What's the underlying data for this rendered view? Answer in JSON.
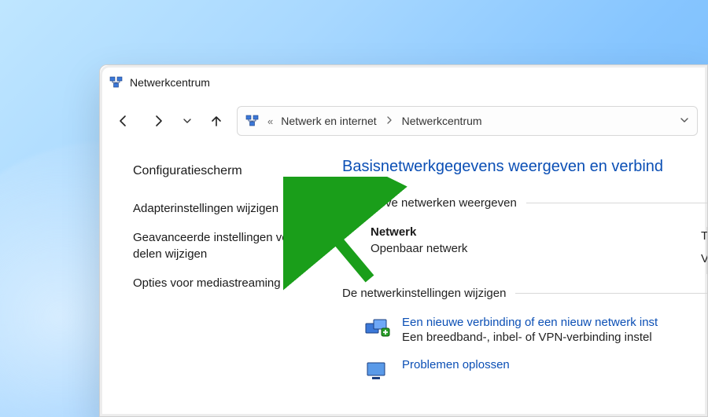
{
  "titlebar": {
    "title": "Netwerkcentrum"
  },
  "nav": {
    "address_prefix": "«",
    "segments": [
      "Netwerk en internet",
      "Netwerkcentrum"
    ]
  },
  "sidebar": {
    "heading": "Configuratiescherm",
    "links": [
      "Adapterinstellingen wijzigen",
      "Geavanceerde instellingen voor delen wijzigen",
      "Opties voor mediastreaming"
    ]
  },
  "main": {
    "title": "Basisnetwerkgegevens weergeven en verbind",
    "active_label": "De actieve netwerken weergeven",
    "network_name": "Netwerk",
    "network_type": "Openbaar netwerk",
    "right_hint_t": "T",
    "right_hint_v": "V",
    "change_label": "De netwerkinstellingen wijzigen",
    "new_conn_link": "Een nieuwe verbinding of een nieuw netwerk inst",
    "new_conn_sub": "Een breedband-, inbel- of VPN-verbinding instel",
    "troubleshoot": "Problemen oplossen"
  }
}
